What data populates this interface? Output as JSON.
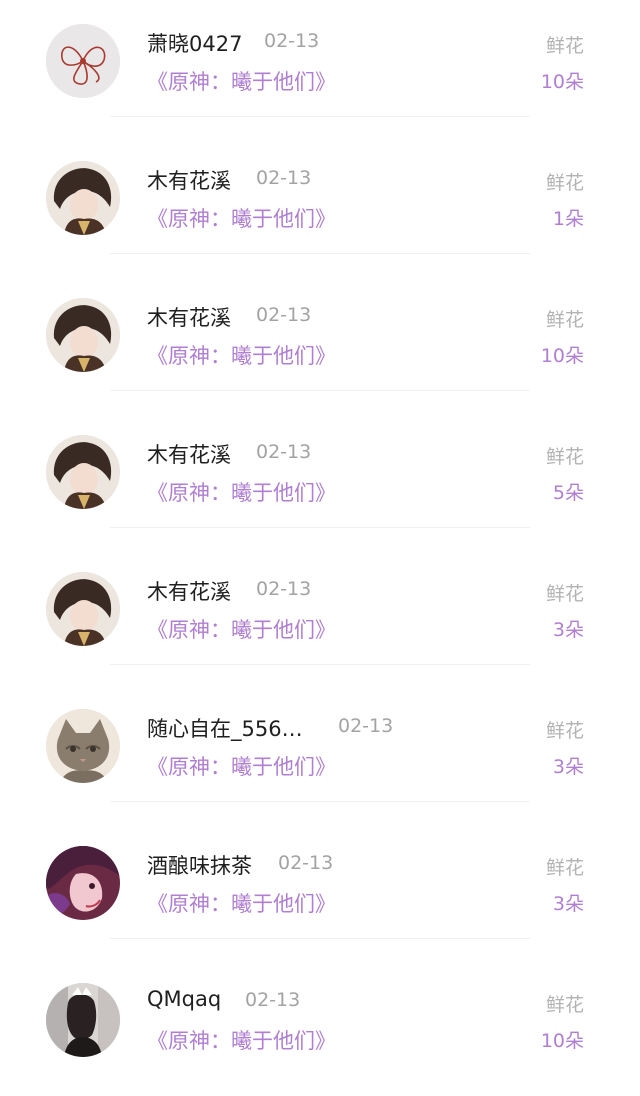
{
  "rows": [
    {
      "avatar": "flower-avatar",
      "name": "萧晓0427",
      "date": "02-13",
      "book": "《原神：曦于他们》",
      "gift": "鲜花",
      "count": "10朵"
    },
    {
      "avatar": "anime-boy-avatar",
      "name": "木有花溪",
      "date": "02-13",
      "book": "《原神：曦于他们》",
      "gift": "鲜花",
      "count": "1朵"
    },
    {
      "avatar": "anime-boy-avatar",
      "name": "木有花溪",
      "date": "02-13",
      "book": "《原神：曦于他们》",
      "gift": "鲜花",
      "count": "10朵"
    },
    {
      "avatar": "anime-boy-avatar",
      "name": "木有花溪",
      "date": "02-13",
      "book": "《原神：曦于他们》",
      "gift": "鲜花",
      "count": "5朵"
    },
    {
      "avatar": "anime-boy-avatar",
      "name": "木有花溪",
      "date": "02-13",
      "book": "《原神：曦于他们》",
      "gift": "鲜花",
      "count": "3朵"
    },
    {
      "avatar": "cat-avatar",
      "name": "随心自在_556…",
      "date": "02-13",
      "book": "《原神：曦于他们》",
      "gift": "鲜花",
      "count": "3朵"
    },
    {
      "avatar": "anime-girl-avatar",
      "name": "酒酿味抹茶",
      "date": "02-13",
      "book": "《原神：曦于他们》",
      "gift": "鲜花",
      "count": "3朵"
    },
    {
      "avatar": "photo-avatar",
      "name": "QMqaq",
      "date": "02-13",
      "book": "《原神：曦于他们》",
      "gift": "鲜花",
      "count": "10朵"
    }
  ],
  "colors": {
    "accent": "#b07fd1",
    "name": "#1f1f1f",
    "muted": "#a3a3a3",
    "divider": "#f1f1f1"
  }
}
